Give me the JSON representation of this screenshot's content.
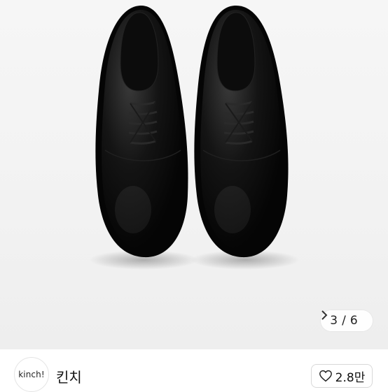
{
  "product_image": {
    "alt_icon": "product-photo"
  },
  "pager": {
    "current": "3",
    "separator": "/",
    "total": "6",
    "next_icon": "chevron-right-icon"
  },
  "shop": {
    "avatar_text": "kinch!",
    "name": "킨치"
  },
  "like": {
    "icon": "heart-icon",
    "count": "2.8만"
  },
  "colors": {
    "background": "#ffffff",
    "photo_bg": "#f2f2f2",
    "shoe": "#0b0b0b"
  }
}
